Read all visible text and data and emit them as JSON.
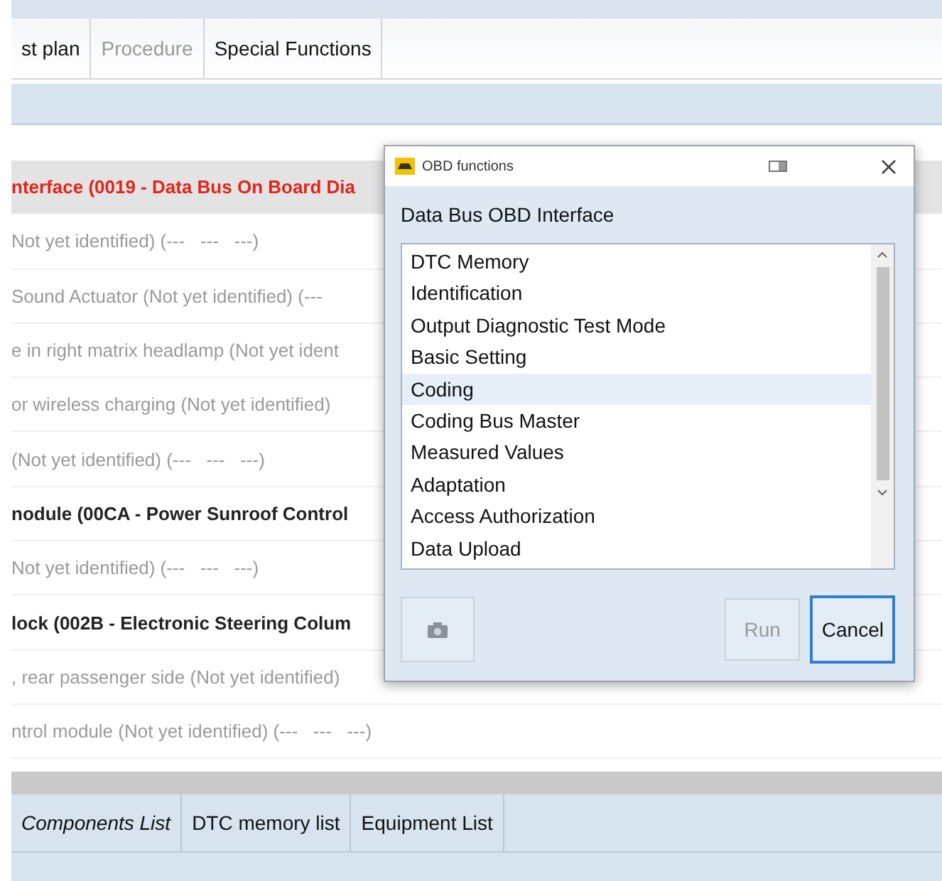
{
  "top_tabs": [
    {
      "label": "st plan",
      "disabled": false
    },
    {
      "label": "Procedure",
      "disabled": true
    },
    {
      "label": "Special Functions",
      "disabled": false
    }
  ],
  "modules": [
    {
      "text": "nterface (0019 - Data Bus On Board Dia",
      "kind": "fault",
      "selected": true
    },
    {
      "text": "Not yet identified) (---   ---   ---)",
      "kind": "unknown",
      "selected": false
    },
    {
      "text": "Sound Actuator (Not yet identified) (---",
      "kind": "unknown",
      "selected": false
    },
    {
      "text": "e in right matrix headlamp (Not yet ident",
      "kind": "unknown",
      "selected": false
    },
    {
      "text": "or wireless charging (Not yet identified)",
      "kind": "unknown",
      "selected": false
    },
    {
      "text": "(Not yet identified) (---   ---   ---)",
      "kind": "unknown",
      "selected": false
    },
    {
      "text": "nodule (00CA - Power Sunroof Control",
      "kind": "ok",
      "selected": false
    },
    {
      "text": "Not yet identified) (---   ---   ---)",
      "kind": "unknown",
      "selected": false
    },
    {
      "text": "lock (002B - Electronic Steering Colum",
      "kind": "ok",
      "selected": false
    },
    {
      "text": ", rear passenger side (Not yet identified)",
      "kind": "unknown",
      "selected": false
    },
    {
      "text": "ntrol module (Not yet identified) (---   ---   ---)",
      "kind": "unknown",
      "selected": false
    }
  ],
  "bottom_tabs": [
    {
      "label": "Components List",
      "selected": true
    },
    {
      "label": "DTC memory list",
      "selected": false
    },
    {
      "label": "Equipment List",
      "selected": false
    }
  ],
  "dialog": {
    "title": "OBD functions",
    "heading": "Data Bus OBD Interface",
    "items": [
      {
        "label": "DTC Memory",
        "selected": false
      },
      {
        "label": "Identification",
        "selected": false
      },
      {
        "label": "Output Diagnostic Test Mode",
        "selected": false
      },
      {
        "label": "Basic Setting",
        "selected": false
      },
      {
        "label": "Coding",
        "selected": true
      },
      {
        "label": "Coding Bus Master",
        "selected": false
      },
      {
        "label": "Measured Values",
        "selected": false
      },
      {
        "label": "Adaptation",
        "selected": false
      },
      {
        "label": "Access Authorization",
        "selected": false
      },
      {
        "label": "Data Upload",
        "selected": false
      }
    ],
    "buttons": [
      {
        "label": "Run",
        "disabled": true,
        "focused": false
      },
      {
        "label": "Cancel",
        "disabled": false,
        "focused": true
      }
    ]
  }
}
